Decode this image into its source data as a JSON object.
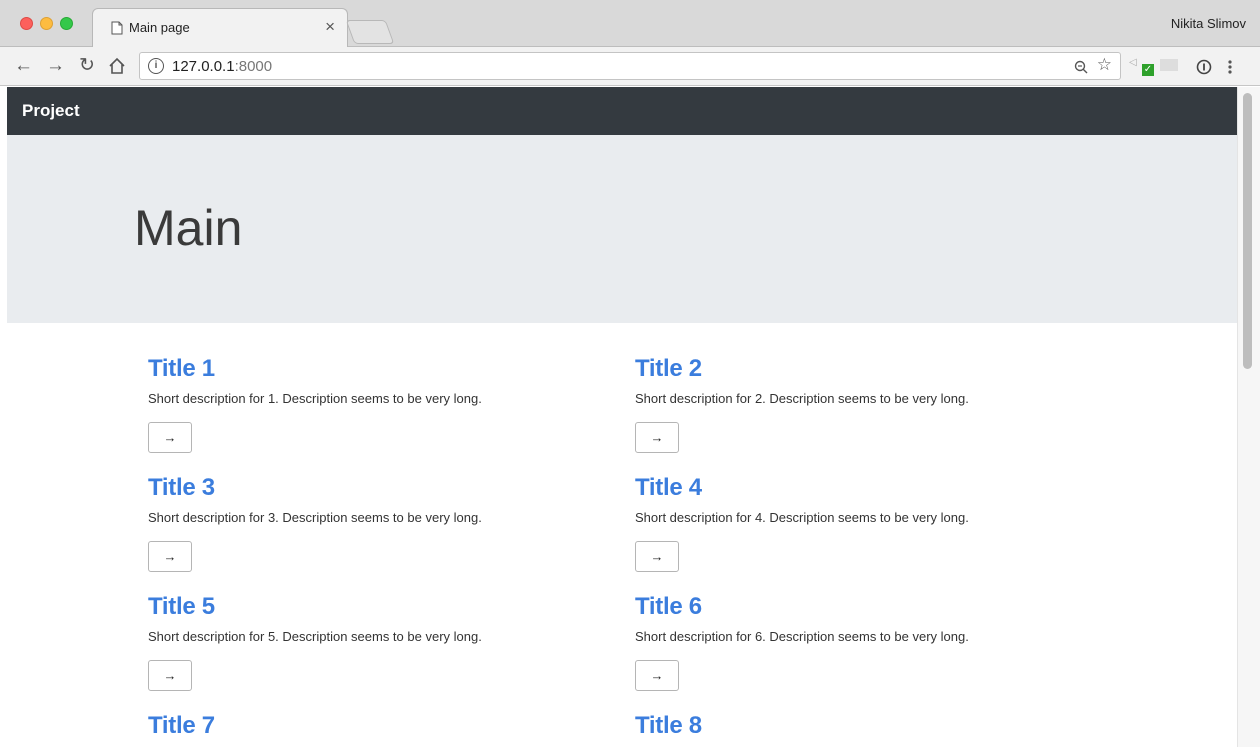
{
  "browser": {
    "tab_title": "Main page",
    "tab_close": "×",
    "profile_name": "Nikita Slimov",
    "url_host": "127.0.0.1",
    "url_port": ":8000",
    "info_glyph": "i",
    "icons": [
      "back-icon",
      "forward-icon",
      "reload-icon",
      "home-icon",
      "info-icon",
      "zoom-icon",
      "star-icon",
      "extension-icon",
      "menu-icon"
    ]
  },
  "navbar": {
    "brand": "Project"
  },
  "jumbotron": {
    "title": "Main"
  },
  "cards": [
    {
      "title": "Title 1",
      "description": "Short description for 1. Description seems to be very long.",
      "button": "→"
    },
    {
      "title": "Title 2",
      "description": "Short description for 2. Description seems to be very long.",
      "button": "→"
    },
    {
      "title": "Title 3",
      "description": "Short description for 3. Description seems to be very long.",
      "button": "→"
    },
    {
      "title": "Title 4",
      "description": "Short description for 4. Description seems to be very long.",
      "button": "→"
    },
    {
      "title": "Title 5",
      "description": "Short description for 5. Description seems to be very long.",
      "button": "→"
    },
    {
      "title": "Title 6",
      "description": "Short description for 6. Description seems to be very long.",
      "button": "→"
    },
    {
      "title": "Title 7",
      "description": "",
      "button": ""
    },
    {
      "title": "Title 8",
      "description": "",
      "button": ""
    }
  ],
  "colors": {
    "navbar_bg": "#343a40",
    "jumbotron_bg": "#e9ecef",
    "link": "#3b7ddd"
  }
}
